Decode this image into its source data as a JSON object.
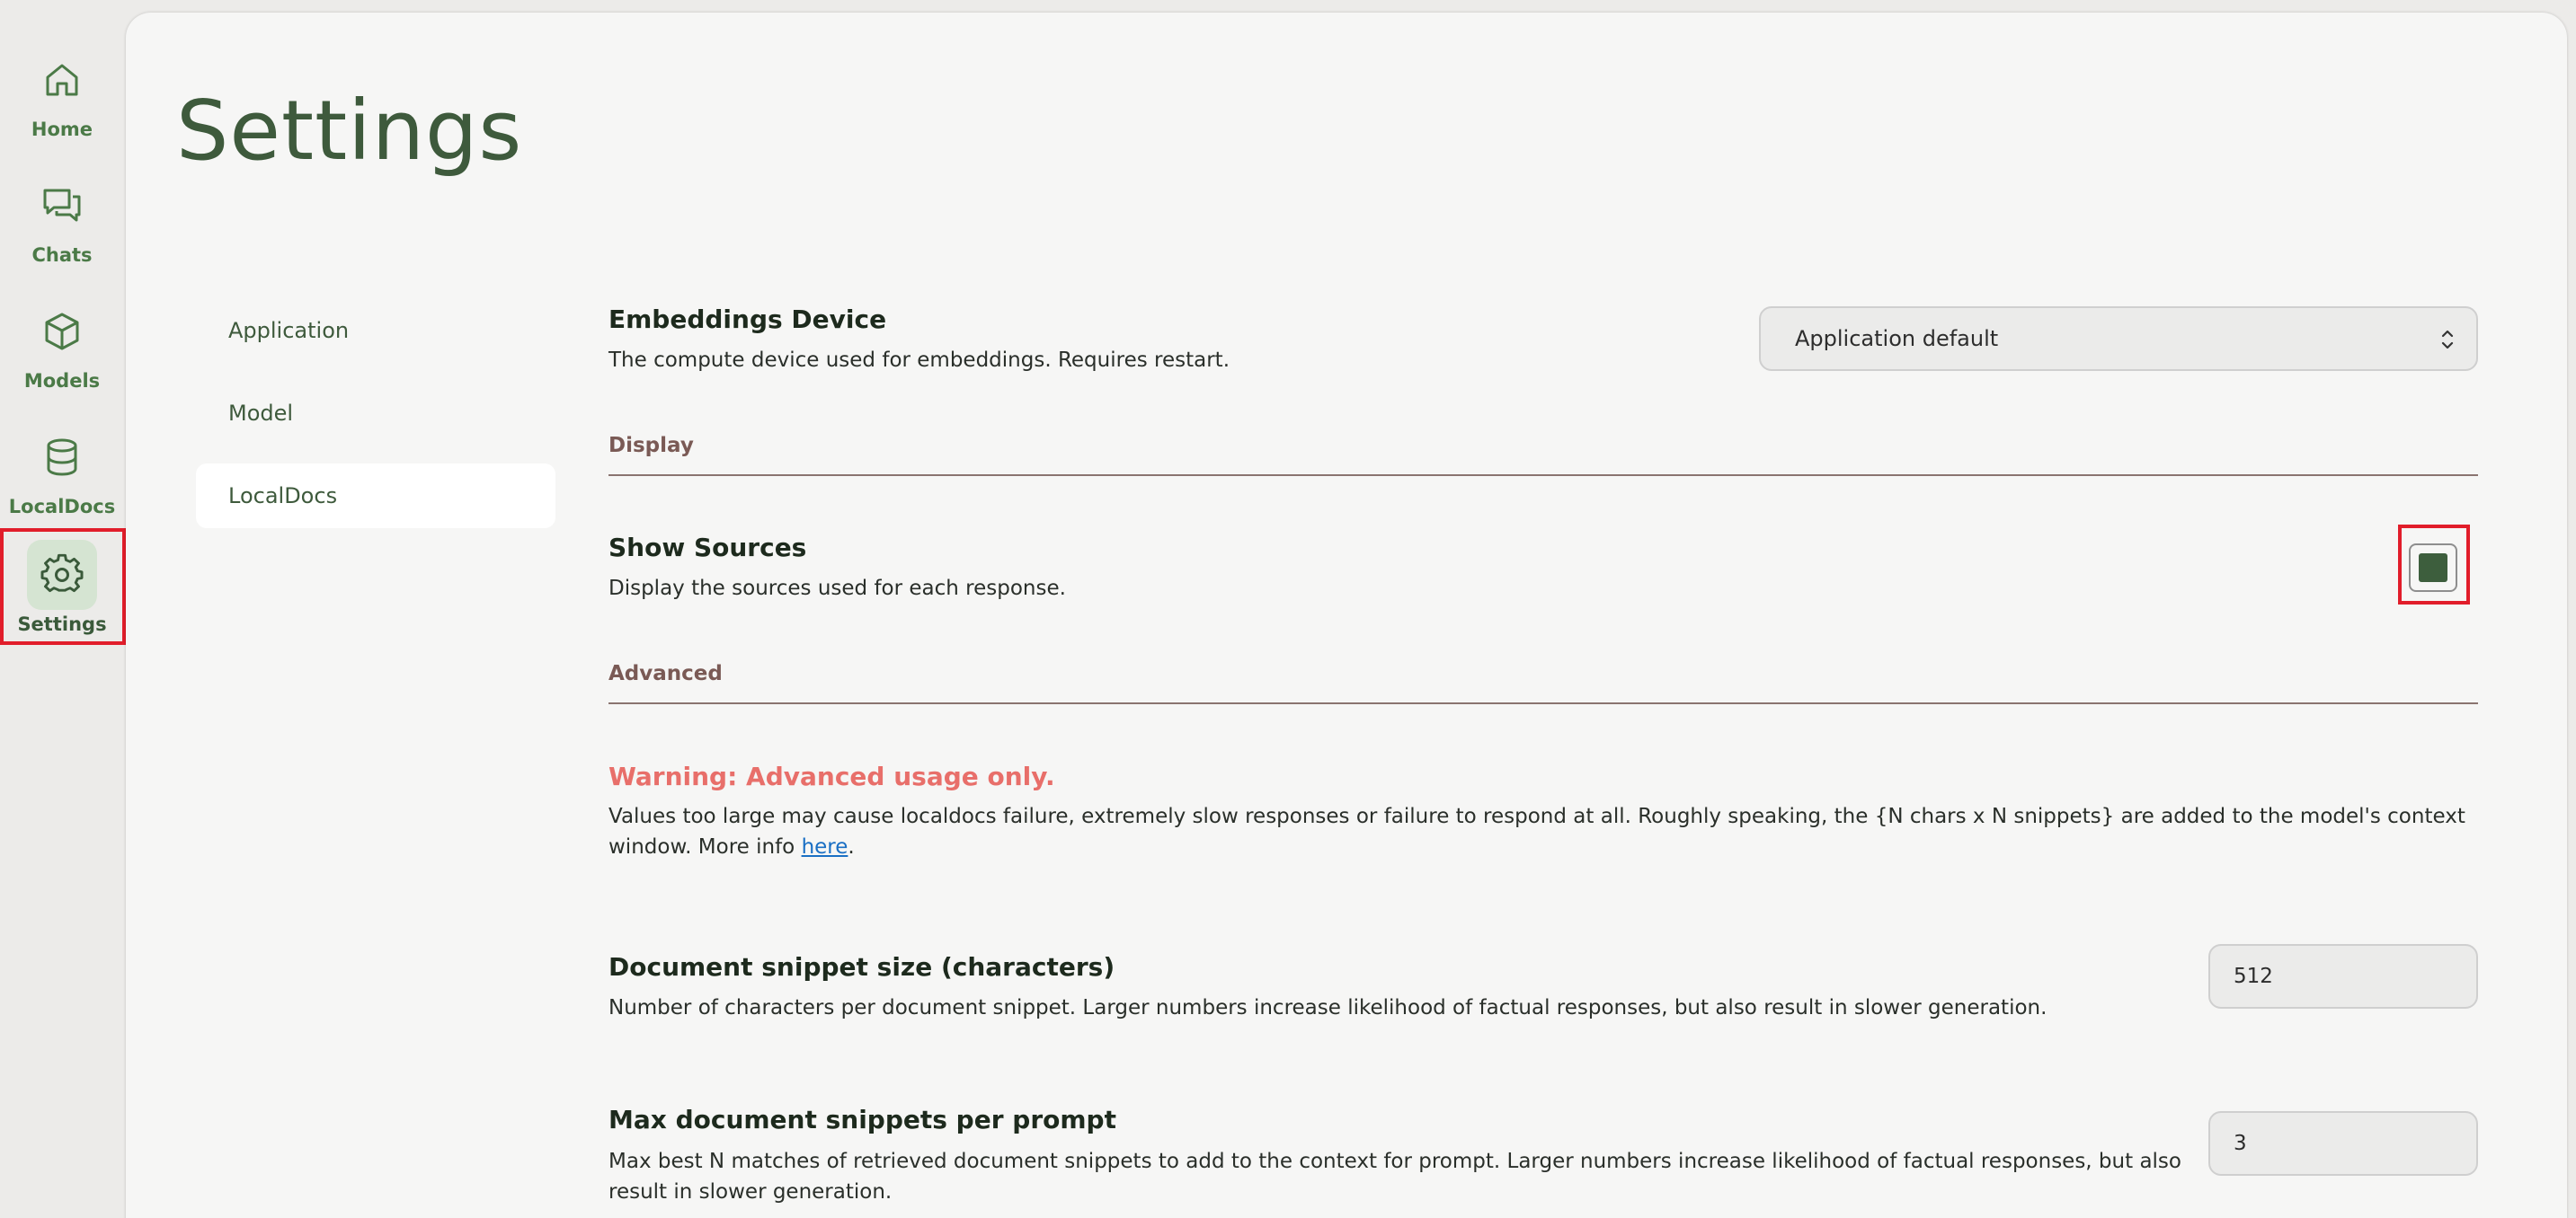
{
  "nav": {
    "items": [
      {
        "label": "Home",
        "icon": "home-icon"
      },
      {
        "label": "Chats",
        "icon": "chats-icon"
      },
      {
        "label": "Models",
        "icon": "models-icon"
      },
      {
        "label": "LocalDocs",
        "icon": "database-icon"
      },
      {
        "label": "Settings",
        "icon": "gear-icon",
        "active": true
      }
    ]
  },
  "page": {
    "title": "Settings"
  },
  "subnav": {
    "items": [
      {
        "label": "Application"
      },
      {
        "label": "Model"
      },
      {
        "label": "LocalDocs",
        "active": true
      }
    ]
  },
  "embeddings": {
    "title": "Embeddings Device",
    "desc": "The compute device used for embeddings. Requires restart.",
    "value": "Application default"
  },
  "display": {
    "section": "Display",
    "show_sources_title": "Show Sources",
    "show_sources_desc": "Display the sources used for each response.",
    "show_sources_checked": true
  },
  "advanced": {
    "section": "Advanced",
    "warning": "Warning: Advanced usage only.",
    "warning_desc": "Values too large may cause localdocs failure, extremely slow responses or failure to respond at all. Roughly speaking, the {N chars x N snippets} are added to the model's context window. More info",
    "warning_link": "here",
    "warning_tail": ".",
    "snippet_size_title": "Document snippet size (characters)",
    "snippet_size_desc": "Number of characters per document snippet. Larger numbers increase likelihood of factual responses, but also result in slower generation.",
    "snippet_size_value": "512",
    "max_snippets_title": "Max document snippets per prompt",
    "max_snippets_desc": "Max best N matches of retrieved document snippets to add to the context for prompt. Larger numbers increase likelihood of factual responses, but also result in slower generation.",
    "max_snippets_value": "3"
  },
  "colors": {
    "accent": "#3d5e3d",
    "highlight": "#e11d2a",
    "warning": "#e86f6a",
    "link": "#1a6fc4"
  }
}
